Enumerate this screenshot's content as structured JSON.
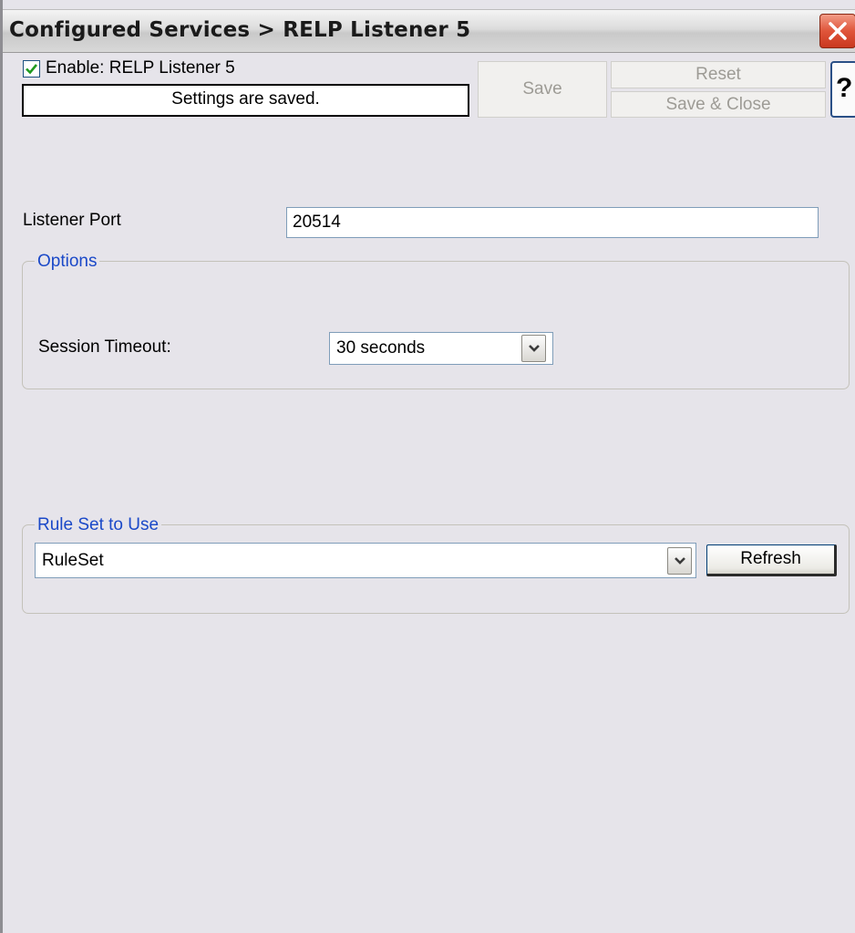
{
  "window": {
    "title": "Configured Services > RELP Listener 5"
  },
  "header": {
    "enable_label": "Enable: RELP Listener 5",
    "enable_checked": true,
    "status": "Settings are saved.",
    "save_label": "Save",
    "reset_label": "Reset",
    "save_close_label": "Save & Close",
    "help_label": "?"
  },
  "settings": {
    "listener_port_label": "Listener Port",
    "listener_port_value": "20514"
  },
  "options": {
    "legend": "Options",
    "session_timeout_label": "Session Timeout:",
    "session_timeout_value": "30 seconds"
  },
  "ruleset": {
    "legend": "Rule Set to Use",
    "selected": "RuleSet",
    "refresh_label": "Refresh"
  },
  "colors": {
    "legend_text": "#1b49c8",
    "checkmark": "#1f9a1f",
    "close_button": "#e0553a"
  },
  "icons": {
    "close": "close-icon",
    "checkbox": "checkmark-icon",
    "dropdown": "chevron-down-icon"
  }
}
